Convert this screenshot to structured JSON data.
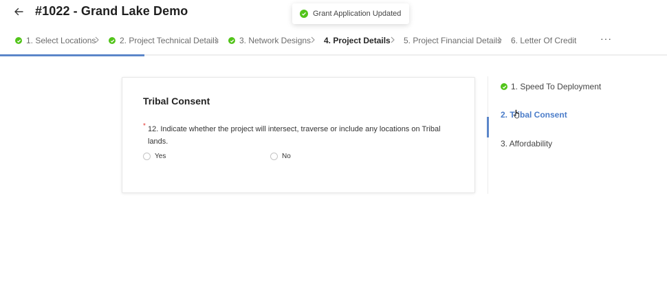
{
  "header": {
    "title": "#1022 - Grand Lake Demo",
    "back_icon": "arrow-left-icon"
  },
  "toast": {
    "message": "Grant Application Updated",
    "status": "success",
    "color": "#52c41a"
  },
  "steps": [
    {
      "label": "1. Select Locations",
      "completed": true,
      "active": false
    },
    {
      "label": "2. Project Technical Details",
      "completed": true,
      "active": false
    },
    {
      "label": "3. Network Designs",
      "completed": true,
      "active": false
    },
    {
      "label": "4. Project Details",
      "completed": false,
      "active": true
    },
    {
      "label": "5. Project Financial Details",
      "completed": false,
      "active": false
    },
    {
      "label": "6. Letter Of Credit",
      "completed": false,
      "active": false
    }
  ],
  "more_label": "···",
  "colors": {
    "accent": "#5b86c9",
    "success": "#52c41a",
    "required": "#e53935"
  },
  "section": {
    "title": "Tribal Consent",
    "required_mark": "*",
    "question": "12. Indicate whether the project will intersect, traverse or include any locations on Tribal lands.",
    "options": [
      "Yes",
      "No"
    ]
  },
  "side_nav": [
    {
      "label": "1. Speed To Deployment",
      "completed": true,
      "active": false
    },
    {
      "label": "2. Tribal Consent",
      "completed": false,
      "active": true
    },
    {
      "label": "3. Affordability",
      "completed": false,
      "active": false
    }
  ]
}
